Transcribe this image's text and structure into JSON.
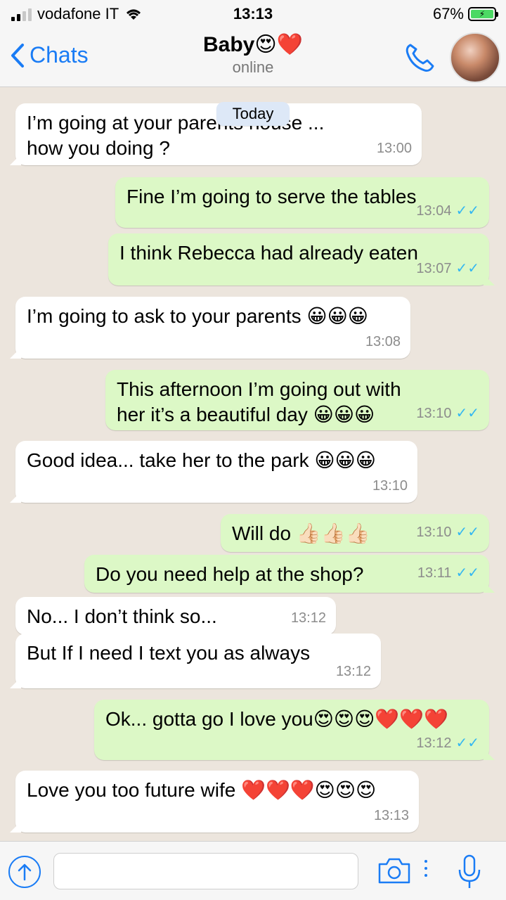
{
  "status_bar": {
    "carrier": "vodafone IT",
    "time": "13:13",
    "battery": "67%"
  },
  "header": {
    "back_label": "Chats",
    "contact_name": "Baby😍❤️",
    "contact_status": "online"
  },
  "date_separator": "Today",
  "messages": [
    {
      "dir": "in",
      "text": "I’m going at your parents house  ... how you doing ?",
      "time": "13:00"
    },
    {
      "dir": "out",
      "text": "Fine I’m going to serve the tables",
      "time": "13:04"
    },
    {
      "dir": "out",
      "text": "I think Rebecca had already eaten",
      "time": "13:07"
    },
    {
      "dir": "in",
      "text": "I’m going to ask to your parents 😀😀😀",
      "time": "13:08"
    },
    {
      "dir": "out",
      "text": "This afternoon I’m going out with her it’s a beautiful day 😀😀😀",
      "time": "13:10"
    },
    {
      "dir": "in",
      "text": "Good idea... take her to the park 😀😀😀",
      "time": "13:10"
    },
    {
      "dir": "out",
      "text": "Will do 👍🏻👍🏻👍🏻",
      "time": "13:10"
    },
    {
      "dir": "out",
      "text": "Do you need help at the shop?",
      "time": "13:11"
    },
    {
      "dir": "in",
      "text": "No... I don’t think so...",
      "time": "13:12"
    },
    {
      "dir": "in",
      "text": "But If I need I text you as always",
      "time": "13:12"
    },
    {
      "dir": "out",
      "text": "Ok... gotta go I love you😍😍😍❤️❤️❤️",
      "time": "13:12"
    },
    {
      "dir": "in",
      "text": "Love you too future wife ❤️❤️❤️😍😍😍",
      "time": "13:13"
    }
  ],
  "input": {
    "placeholder": ""
  },
  "icons": {
    "back": "chevron-left-icon",
    "call": "phone-icon",
    "attach": "arrow-up-icon",
    "camera": "camera-icon",
    "mic": "microphone-icon"
  },
  "colors": {
    "accent": "#1a7cf5",
    "outgoing_bubble": "#dcf8c6",
    "incoming_bubble": "#ffffff",
    "read_ticks": "#34b7f1",
    "background": "#ece5dd"
  }
}
